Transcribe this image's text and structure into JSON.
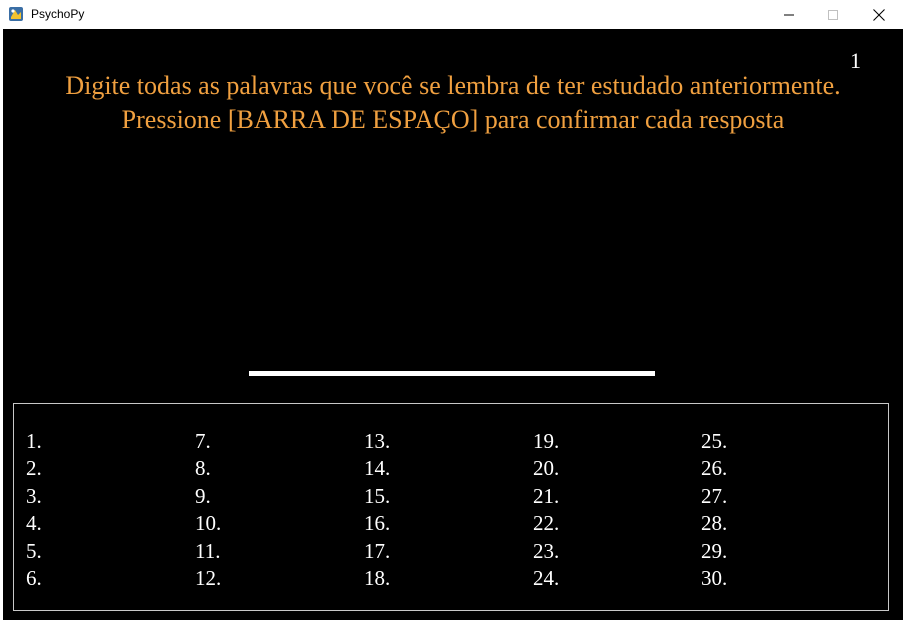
{
  "window": {
    "title": "PsychoPy",
    "icons": {
      "app": "psychopy-app-icon",
      "minimize": "minimize-icon",
      "maximize": "maximize-icon",
      "close": "close-icon"
    }
  },
  "experiment": {
    "counter": "1",
    "instructions": "Digite todas as palavras que você se lembra de ter estudado anteriormente. Pressione [BARRA DE ESPAÇO] para confirmar cada resposta",
    "answer_columns": [
      [
        "1.",
        "2.",
        "3.",
        "4.",
        "5.",
        "6."
      ],
      [
        "7.",
        "8.",
        "9.",
        "10.",
        "11.",
        "12."
      ],
      [
        "13.",
        "14.",
        "15.",
        "16.",
        "17.",
        "18."
      ],
      [
        "19.",
        "20.",
        "21.",
        "22.",
        "23.",
        "24."
      ],
      [
        "25.",
        "26.",
        "27.",
        "28.",
        "29.",
        "30."
      ]
    ]
  },
  "colors": {
    "background": "#000000",
    "instruction_text": "#f0a040",
    "text": "#ffffff",
    "box_border": "#c8c8c8"
  }
}
